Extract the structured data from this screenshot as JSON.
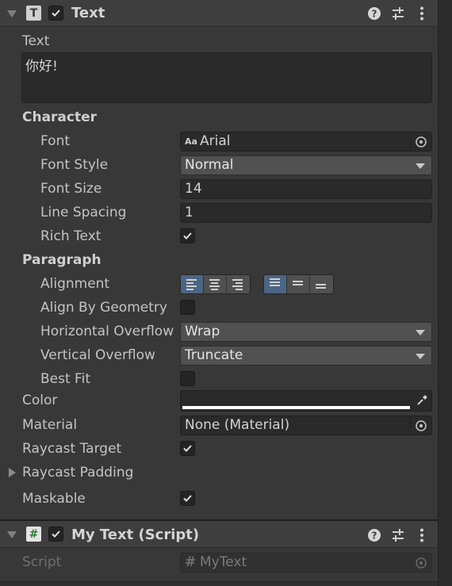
{
  "text_component": {
    "title": "Text",
    "icon_glyph": "T",
    "enabled": true,
    "text_label": "Text",
    "text_value": "你好!",
    "character_header": "Character",
    "font_label": "Font",
    "font_value": "Arial",
    "font_prefix": "Aa",
    "font_style_label": "Font Style",
    "font_style_value": "Normal",
    "font_size_label": "Font Size",
    "font_size_value": "14",
    "line_spacing_label": "Line Spacing",
    "line_spacing_value": "1",
    "rich_text_label": "Rich Text",
    "rich_text_checked": true,
    "paragraph_header": "Paragraph",
    "alignment_label": "Alignment",
    "horizontal_alignment": "left",
    "vertical_alignment": "top",
    "align_by_geometry_label": "Align By Geometry",
    "align_by_geometry_checked": false,
    "horizontal_overflow_label": "Horizontal Overflow",
    "horizontal_overflow_value": "Wrap",
    "vertical_overflow_label": "Vertical Overflow",
    "vertical_overflow_value": "Truncate",
    "best_fit_label": "Best Fit",
    "best_fit_checked": false,
    "color_label": "Color",
    "color_value": "#FFFFFF",
    "material_label": "Material",
    "material_value": "None (Material)",
    "raycast_target_label": "Raycast Target",
    "raycast_target_checked": true,
    "raycast_padding_label": "Raycast Padding",
    "maskable_label": "Maskable",
    "maskable_checked": true
  },
  "script_component": {
    "title": "My Text (Script)",
    "icon_glyph": "#",
    "enabled": true,
    "script_label": "Script",
    "script_value": "MyText",
    "script_prefix": "#"
  },
  "icons": {
    "help": "help-icon",
    "presets": "presets-icon",
    "menu": "kebab-menu-icon",
    "object_picker": "object-picker-icon",
    "eyedropper": "eyedropper-icon"
  },
  "colors": {
    "accent": "#4b6584",
    "background": "#383838",
    "field": "#2a2a2a"
  }
}
